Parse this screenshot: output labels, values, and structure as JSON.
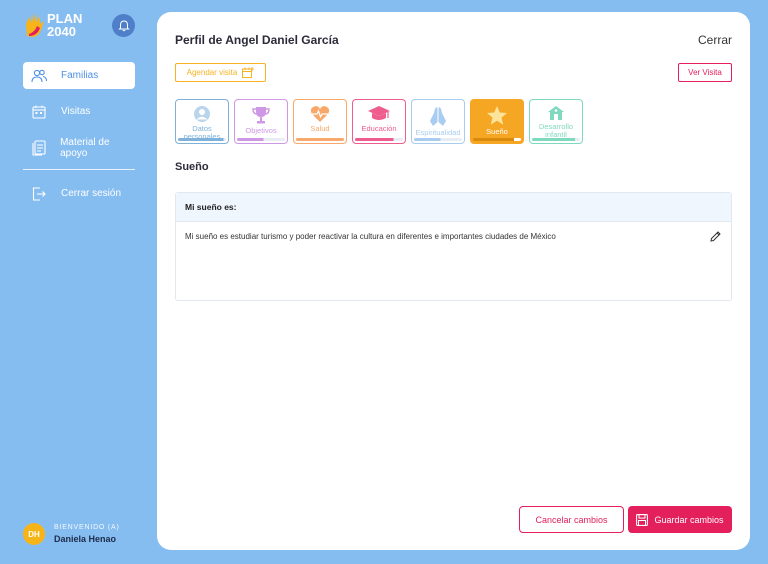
{
  "logo": {
    "line1": "PLAN",
    "line2": "2040"
  },
  "sidebar": {
    "items": [
      {
        "label": "Familias",
        "icon": "people-icon",
        "active": true
      },
      {
        "label": "Visitas",
        "icon": "calendar-icon",
        "active": false
      },
      {
        "label": "Material de apoyo",
        "icon": "document-icon",
        "active": false
      }
    ],
    "logout": "Cerrar sesión"
  },
  "user": {
    "initials": "DH",
    "welcome": "BIENVENIDO (A)",
    "name": "Daniela Henao"
  },
  "header": {
    "title": "Perfil de Angel Daniel García",
    "close": "Cerrar"
  },
  "actions": {
    "schedule": "Agendar visita",
    "view_visit": "Ver Visita"
  },
  "tabs": [
    {
      "label": "Datos personales",
      "icon": "person-icon",
      "color": "#7fb2da",
      "progress": 0.95,
      "active": false
    },
    {
      "label": "Objetivos",
      "icon": "trophy-icon",
      "color": "#cf98e6",
      "progress": 0.55,
      "active": false
    },
    {
      "label": "Salud",
      "icon": "heart-pulse-icon",
      "color": "#f7a86a",
      "progress": 1.0,
      "active": false
    },
    {
      "label": "Educación",
      "icon": "graduation-cap-icon",
      "color": "#ef5d8e",
      "progress": 0.8,
      "active": false
    },
    {
      "label": "Espiritualidad",
      "icon": "praying-hands-icon",
      "color": "#a9cdf0",
      "progress": 0.55,
      "active": false
    },
    {
      "label": "Sueño",
      "icon": "star-icon",
      "color": "#f5a623",
      "progress": 0.85,
      "active": true
    },
    {
      "label": "Desarrollo infantil",
      "icon": "house-icon",
      "color": "#7fd9bf",
      "progress": 0.9,
      "active": false
    }
  ],
  "section": {
    "title": "Sueño"
  },
  "card": {
    "header": "Mi sueño es:",
    "body": "Mi sueño es estudiar turismo y poder reactivar la cultura en diferentes e importantes ciudades de México"
  },
  "footer": {
    "cancel": "Cancelar cambios",
    "save": "Guardar cambios"
  }
}
